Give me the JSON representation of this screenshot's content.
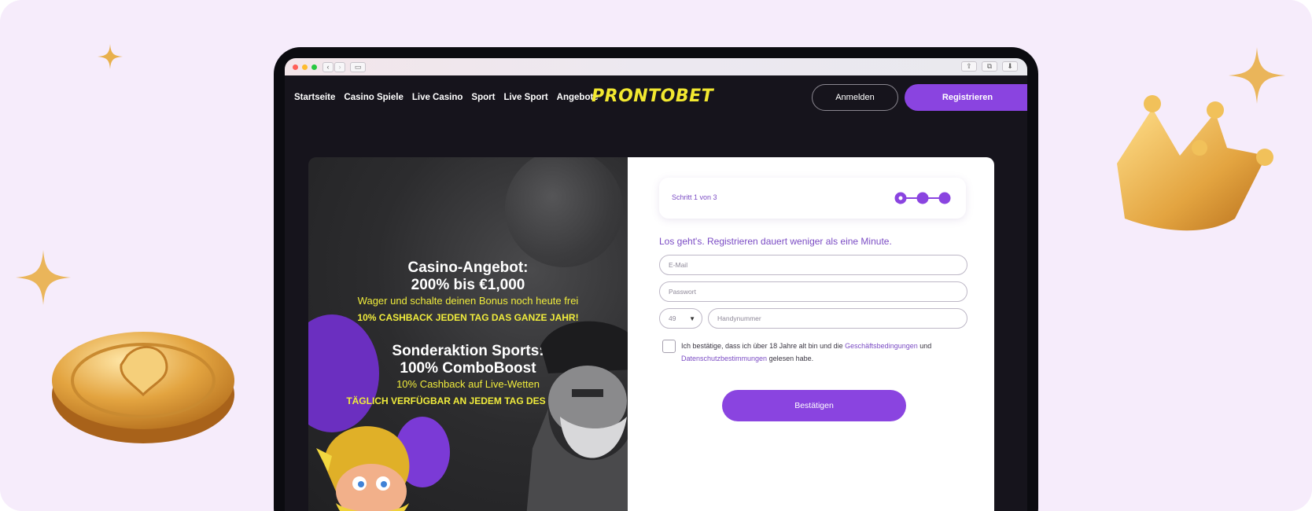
{
  "browser": {
    "traffic_lights": [
      "#ff5f57",
      "#febc2e",
      "#28c840"
    ],
    "icons": [
      "chevron-left-icon",
      "chevron-right-icon",
      "sidebar-icon",
      "share-icon",
      "tabs-icon",
      "download-icon"
    ]
  },
  "nav": {
    "links": [
      "Startseite",
      "Casino Spiele",
      "Live Casino",
      "Sport",
      "Live Sport",
      "Angebote"
    ],
    "logo": "PRONTOBET",
    "login_label": "Anmelden",
    "register_label": "Registrieren"
  },
  "promo": {
    "casino_title": "Casino-Angebot:",
    "casino_offer": "200% bis €1,000",
    "casino_sub": "Wager und schalte deinen Bonus noch heute frei",
    "casino_cashback": "10% CASHBACK JEDEN TAG DAS GANZE JAHR!",
    "sports_title": "Sonderaktion Sports:",
    "sports_offer": "100% ComboBoost",
    "sports_sub": "10% Cashback auf Live-Wetten",
    "sports_daily": "TÄGLICH VERFÜGBAR AN JEDEM TAG DES JAHRES!"
  },
  "form": {
    "step_label": "Schritt 1 von 3",
    "step_current": 1,
    "step_total": 3,
    "headline": "Los geht's. Registrieren dauert weniger als eine Minute.",
    "email_placeholder": "E-Mail",
    "password_placeholder": "Passwort",
    "country_code": "49",
    "phone_placeholder": "Handynummer",
    "consent_prefix": "Ich bestätige, dass ich über 18 Jahre alt bin und die",
    "consent_terms": "Geschäftsbedingungen",
    "consent_and": "und",
    "consent_privacy": "Datenschutzbestimmungen",
    "consent_suffix": "gelesen habe.",
    "submit_label": "Bestätigen"
  },
  "colors": {
    "background": "#f6ecfb",
    "accent": "#8a44e0",
    "logo": "#f2e830",
    "promo_yellow": "#f0ec3c",
    "nav_bg": "#16141c"
  }
}
